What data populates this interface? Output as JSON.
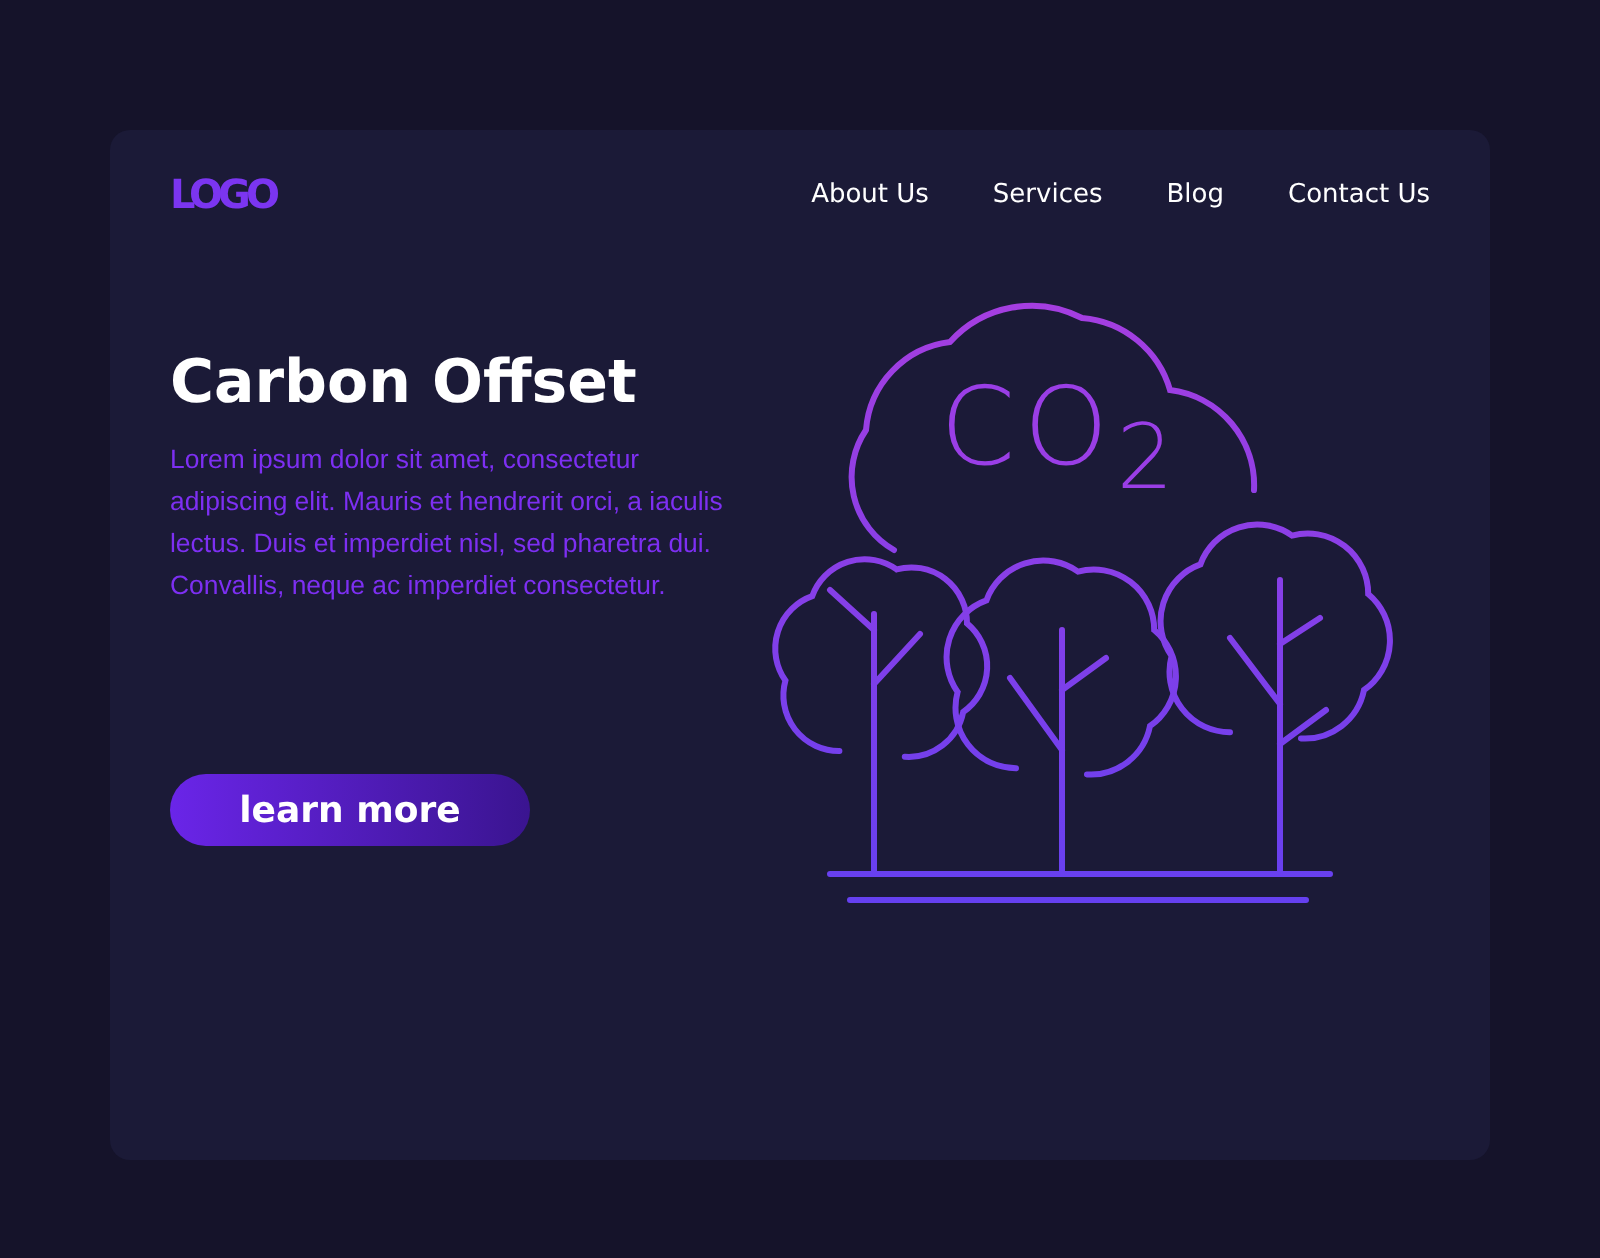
{
  "header": {
    "logo": "LOGO",
    "nav": [
      "About Us",
      "Services",
      "Blog",
      "Contact Us"
    ]
  },
  "hero": {
    "title": "Carbon Offset",
    "text": "Lorem ipsum dolor sit amet, consectetur adipiscing elit. Mauris et hendrerit orci, a iaculis lectus. Duis et imperdiet nisl, sed pharetra dui. Convallis, neque ac imperdiet consectetur.",
    "button": "learn more",
    "illustration_label": "CO$_{2}$"
  }
}
